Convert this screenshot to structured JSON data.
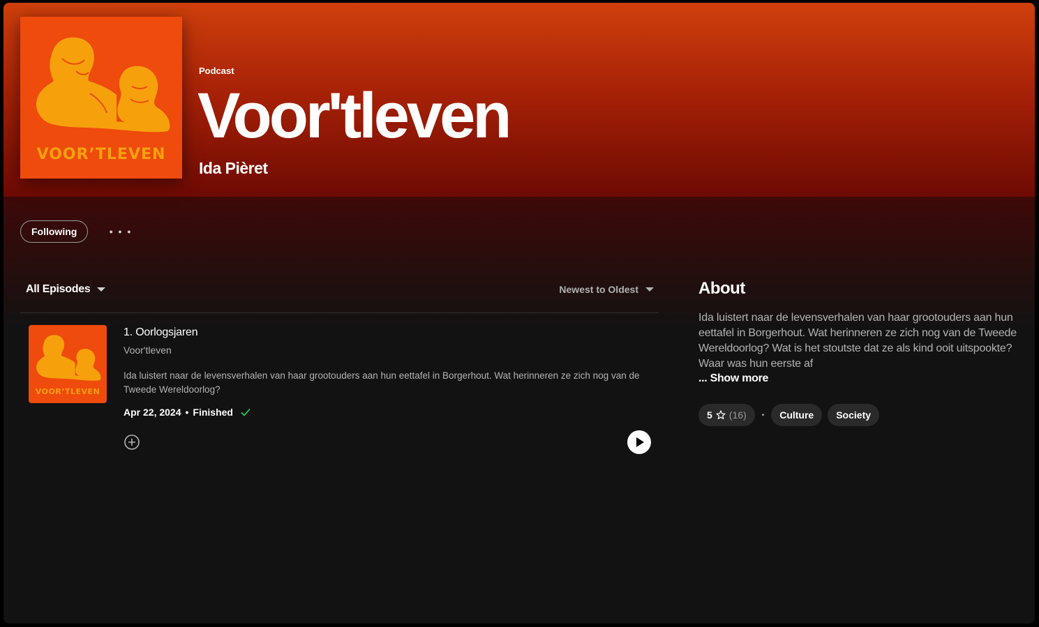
{
  "header": {
    "type_label": "Podcast",
    "title": "Voor'tleven",
    "author": "Ida Pièret",
    "cover_text": "VOOR’TLEVEN",
    "gradient_colors": [
      "#d0400c",
      "#6e0a03"
    ]
  },
  "actions": {
    "follow_label": "Following",
    "more_label": "• • •"
  },
  "episodes_bar": {
    "filter_label": "All Episodes",
    "sort_label": "Newest to Oldest"
  },
  "episodes": [
    {
      "title": "1. Oorlogsjaren",
      "show": "Voor'tleven",
      "description": "Ida luistert naar de levensverhalen van haar grootouders aan hun eettafel in Borgerhout. Wat herinneren ze zich nog van de Tweede Wereldoorlog?",
      "date": "Apr 22, 2024",
      "separator": "•",
      "status": "Finished",
      "status_color": "#1ed760"
    }
  ],
  "about": {
    "heading": "About",
    "text": "Ida luistert naar de levensverhalen van haar grootouders aan hun eettafel in Borgerhout. Wat herinneren ze zich nog van de Tweede Wereldoorlog? Wat is het stoutste dat ze als kind ooit uitspookte? Waar was hun eerste af",
    "show_more": "... Show more",
    "rating": "5",
    "rating_count": "(16)",
    "separator": "•",
    "categories": [
      "Culture",
      "Society"
    ]
  },
  "icons": {
    "star": "star-icon",
    "check": "check-icon",
    "add": "add-circle-icon",
    "play": "play-icon",
    "caret": "caret-down-icon"
  }
}
